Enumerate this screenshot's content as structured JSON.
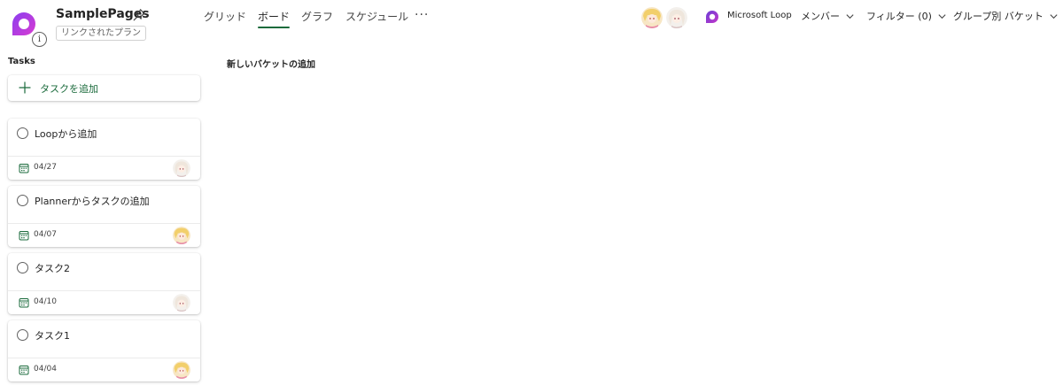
{
  "header": {
    "plan_title": "SamplePages",
    "plan_tag": "リンクされたプラン",
    "info_glyph": "i",
    "tabs": [
      {
        "label": "グリッド",
        "active": false
      },
      {
        "label": "ボード",
        "active": true
      },
      {
        "label": "グラフ",
        "active": false
      },
      {
        "label": "スケジュール",
        "active": false
      }
    ],
    "more_glyph": "···",
    "loop_label": "Microsoft Loop",
    "members_label": "メンバー",
    "filter_label": "フィルター (0)",
    "group_label": "グループ別 バケット"
  },
  "board": {
    "bucket_name": "Tasks",
    "add_task_label": "タスクを追加",
    "new_bucket_label": "新しいバケットの追加",
    "tasks": [
      {
        "title": "Loopから追加",
        "due": "04/27",
        "assignee": "light-hair-avatar"
      },
      {
        "title": "Plannerからタスクの追加",
        "due": "04/07",
        "assignee": "blonde-avatar"
      },
      {
        "title": "タスク2",
        "due": "04/10",
        "assignee": "light-hair-avatar"
      },
      {
        "title": "タスク1",
        "due": "04/04",
        "assignee": "blonde-avatar"
      }
    ]
  },
  "colors": {
    "accent_green": "#1b6b3c",
    "loop_purple": "#6b3fd6",
    "loop_pink": "#c436c9",
    "text_primary": "#242424"
  },
  "icons": {
    "pin": "pin-icon",
    "chevron": "chevron-down-icon",
    "plus": "plus-icon",
    "calendar": "calendar-icon",
    "checkbox": "circle-checkbox-icon"
  }
}
